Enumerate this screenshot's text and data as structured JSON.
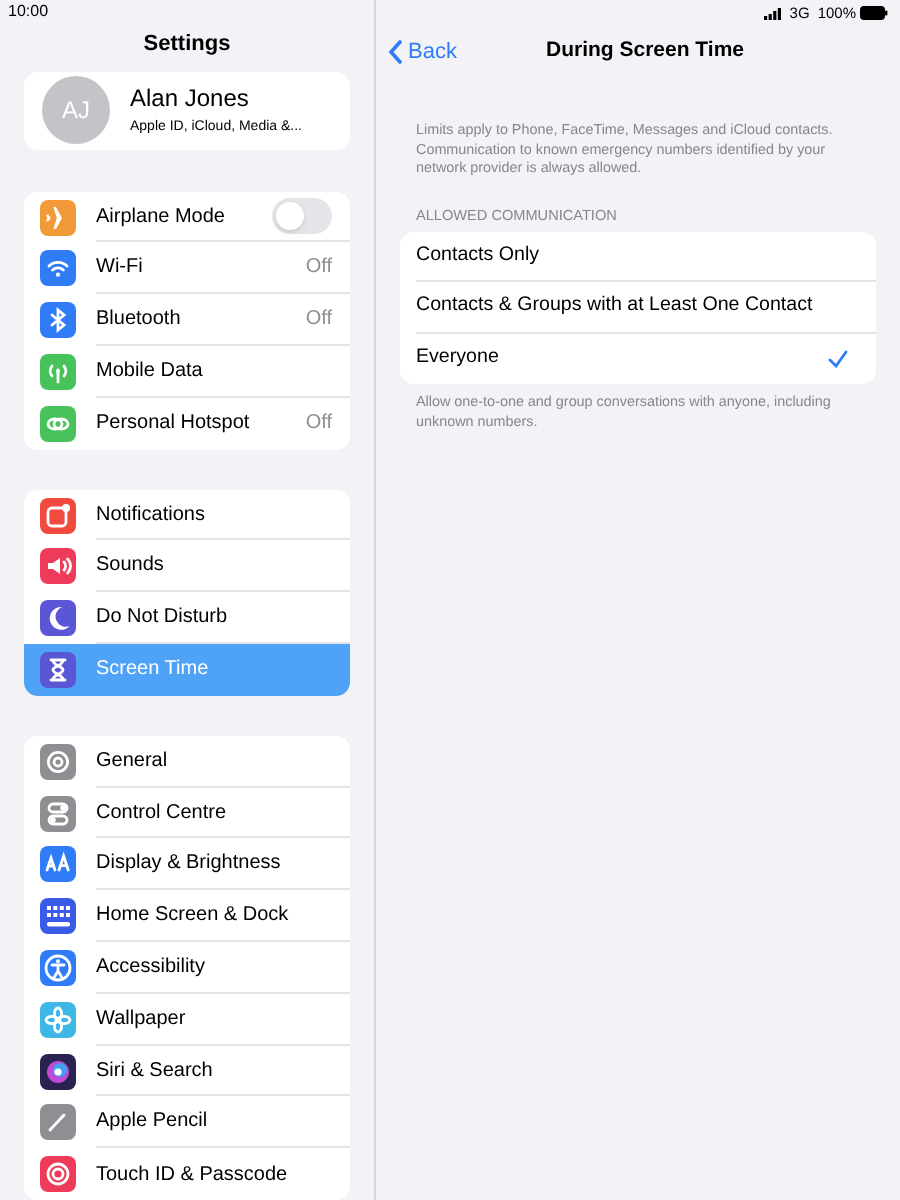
{
  "status_bar": {
    "time": "10:00",
    "network": "3G",
    "battery": "100%"
  },
  "sidebar": {
    "title": "Settings",
    "profile": {
      "initials": "AJ",
      "name": "Alan Jones",
      "subtitle": "Apple ID, iCloud, Media &..."
    },
    "groups": [
      [
        {
          "label": "Airplane Mode",
          "kind": "toggle",
          "on": false,
          "selected": false
        },
        {
          "label": "Wi-Fi",
          "kind": "value",
          "value": "Off",
          "selected": false
        },
        {
          "label": "Bluetooth",
          "kind": "value",
          "value": "Off",
          "selected": false
        },
        {
          "label": "Mobile Data",
          "kind": "plain",
          "selected": false
        },
        {
          "label": "Personal Hotspot",
          "kind": "value",
          "value": "Off",
          "selected": false
        }
      ],
      [
        {
          "label": "Notifications",
          "kind": "plain",
          "selected": false
        },
        {
          "label": "Sounds",
          "kind": "plain",
          "selected": false
        },
        {
          "label": "Do Not Disturb",
          "kind": "plain",
          "selected": false
        },
        {
          "label": "Screen Time",
          "kind": "plain",
          "selected": true
        }
      ],
      [
        {
          "label": "General",
          "kind": "plain",
          "selected": false
        },
        {
          "label": "Control Centre",
          "kind": "plain",
          "selected": false
        },
        {
          "label": "Display & Brightness",
          "kind": "plain",
          "selected": false
        },
        {
          "label": "Home Screen & Dock",
          "kind": "plain",
          "selected": false
        },
        {
          "label": "Accessibility",
          "kind": "plain",
          "selected": false
        },
        {
          "label": "Wallpaper",
          "kind": "plain",
          "selected": false
        },
        {
          "label": "Siri & Search",
          "kind": "plain",
          "selected": false
        },
        {
          "label": "Apple Pencil",
          "kind": "plain",
          "selected": false
        },
        {
          "label": "Touch ID & Passcode",
          "kind": "plain",
          "selected": false
        }
      ]
    ]
  },
  "detail": {
    "back": "Back",
    "title": "During Screen Time",
    "intro": "Limits apply to Phone, FaceTime, Messages and iCloud contacts. Communication to known emergency numbers identified by your network provider is always allowed.",
    "section_header": "ALLOWED COMMUNICATION",
    "options": [
      {
        "label": "Contacts Only",
        "selected": false
      },
      {
        "label": "Contacts & Groups with at Least One Contact",
        "selected": false
      },
      {
        "label": "Everyone",
        "selected": true
      }
    ],
    "footer": "Allow one-to-one and group conversations with anyone, including unknown numbers."
  }
}
